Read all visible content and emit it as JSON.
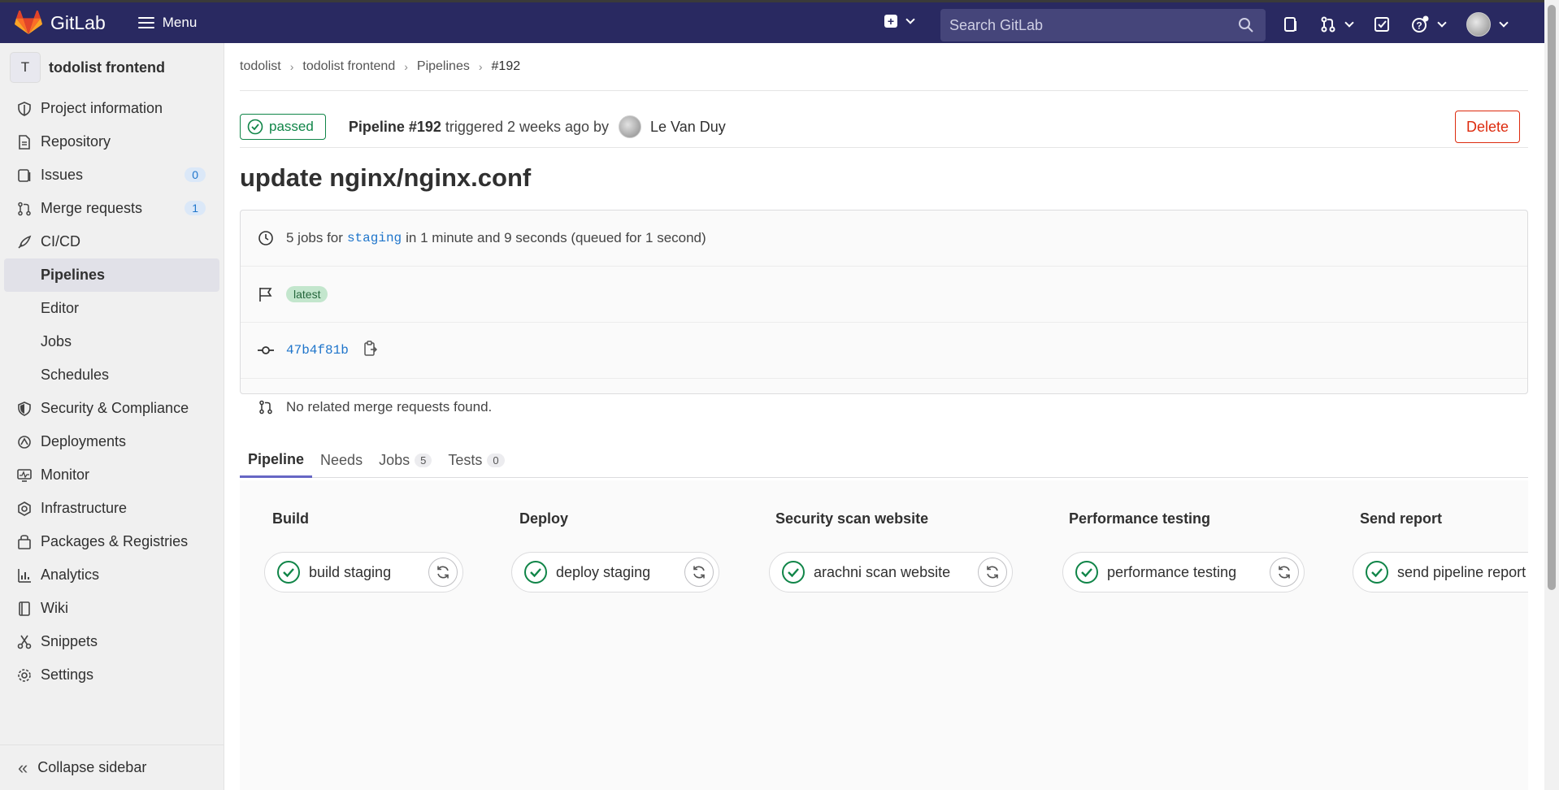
{
  "topbar": {
    "brand": "GitLab",
    "menu_label": "Menu",
    "search_placeholder": "Search GitLab"
  },
  "sidebar": {
    "project_initial": "T",
    "project_name": "todolist frontend",
    "items": [
      {
        "label": "Project information",
        "icon": "info-icon"
      },
      {
        "label": "Repository",
        "icon": "document-icon"
      },
      {
        "label": "Issues",
        "icon": "issues-icon",
        "count": "0"
      },
      {
        "label": "Merge requests",
        "icon": "merge-request-icon",
        "count": "1"
      },
      {
        "label": "CI/CD",
        "icon": "rocket-icon"
      }
    ],
    "cicd_sub": [
      "Pipelines",
      "Editor",
      "Jobs",
      "Schedules"
    ],
    "items2": [
      {
        "label": "Security & Compliance",
        "icon": "shield-icon"
      },
      {
        "label": "Deployments",
        "icon": "deployments-icon"
      },
      {
        "label": "Monitor",
        "icon": "monitor-icon"
      },
      {
        "label": "Infrastructure",
        "icon": "infrastructure-icon"
      },
      {
        "label": "Packages & Registries",
        "icon": "package-icon"
      },
      {
        "label": "Analytics",
        "icon": "chart-icon"
      },
      {
        "label": "Wiki",
        "icon": "book-icon"
      },
      {
        "label": "Snippets",
        "icon": "scissors-icon"
      },
      {
        "label": "Settings",
        "icon": "gear-icon"
      }
    ],
    "collapse_label": "Collapse sidebar"
  },
  "breadcrumb": [
    "todolist",
    "todolist frontend",
    "Pipelines",
    "#192"
  ],
  "pipeline": {
    "status": "passed",
    "title": "Pipeline #192",
    "triggered_text": "triggered 2 weeks ago by",
    "user": "Le Van Duy",
    "delete_label": "Delete",
    "commit_title": "update nginx/nginx.conf",
    "jobs_prefix": "5 jobs for",
    "branch": "staging",
    "jobs_suffix": "in 1 minute and 9 seconds (queued for 1 second)",
    "tag": "latest",
    "commit_sha": "47b4f81b",
    "mr_text": "No related merge requests found."
  },
  "tabs": [
    {
      "label": "Pipeline",
      "count": null
    },
    {
      "label": "Needs",
      "count": null
    },
    {
      "label": "Jobs",
      "count": "5"
    },
    {
      "label": "Tests",
      "count": "0"
    }
  ],
  "stages": [
    {
      "name": "Build",
      "job": "build staging"
    },
    {
      "name": "Deploy",
      "job": "deploy staging"
    },
    {
      "name": "Security scan website",
      "job": "arachni scan website"
    },
    {
      "name": "Performance testing",
      "job": "performance testing"
    },
    {
      "name": "Send report",
      "job": "send pipeline report"
    }
  ],
  "colors": {
    "topbar": "#292961",
    "success": "#108548",
    "danger": "#dd2b0e",
    "link": "#1f75cb"
  }
}
